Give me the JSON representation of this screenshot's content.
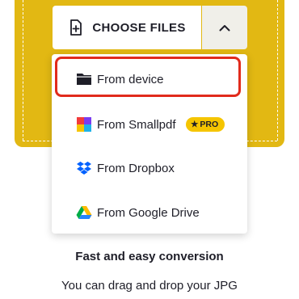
{
  "upload": {
    "choose_label": "CHOOSE FILES",
    "toggle_icon": "chevron-up-icon",
    "accent_color": "#e2b813"
  },
  "menu": {
    "items": [
      {
        "label": "From device",
        "icon": "folder-icon"
      },
      {
        "label": "From Smallpdf",
        "icon": "smallpdf-logo-icon",
        "badge": "PRO"
      },
      {
        "label": "From Dropbox",
        "icon": "dropbox-icon"
      },
      {
        "label": "From Google Drive",
        "icon": "google-drive-icon"
      }
    ],
    "highlight_color": "#e12b1c"
  },
  "info": {
    "heading": "Fast and easy conversion",
    "description": "You can drag and drop your JPG"
  }
}
